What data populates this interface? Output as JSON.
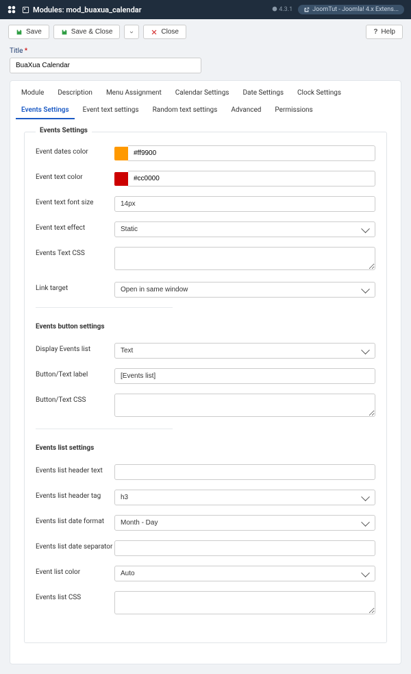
{
  "topbar": {
    "title_prefix": "Modules:",
    "title_name": "mod_buaxua_calendar",
    "version": "4.3.1",
    "ext_link_label": "JoomTut - Joomla! 4.x Extens..."
  },
  "toolbar": {
    "save": "Save",
    "save_close": "Save & Close",
    "close": "Close",
    "help": "Help"
  },
  "title": {
    "label": "Title",
    "value": "BuaXua Calendar"
  },
  "tabs": [
    "Module",
    "Description",
    "Menu Assignment",
    "Calendar Settings",
    "Date Settings",
    "Clock Settings",
    "Events Settings",
    "Event text settings",
    "Random text settings",
    "Advanced",
    "Permissions"
  ],
  "active_tab": "Events Settings",
  "fieldset_legend": "Events Settings",
  "fields": {
    "event_dates_color": {
      "label": "Event dates color",
      "value": "#ff9900",
      "swatch": "#ff9900"
    },
    "event_text_color": {
      "label": "Event text color",
      "value": "#cc0000",
      "swatch": "#cc0000"
    },
    "event_text_font_size": {
      "label": "Event text font size",
      "value": "14px"
    },
    "event_text_effect": {
      "label": "Event text effect",
      "value": "Static"
    },
    "events_text_css": {
      "label": "Events Text CSS",
      "value": ""
    },
    "link_target": {
      "label": "Link target",
      "value": "Open in same window"
    }
  },
  "section2": {
    "head": "Events button settings",
    "display_events_list": {
      "label": "Display Events list",
      "value": "Text"
    },
    "button_text_label": {
      "label": "Button/Text label",
      "value": "[Events list]"
    },
    "button_text_css": {
      "label": "Button/Text CSS",
      "value": ""
    }
  },
  "section3": {
    "head": "Events list settings",
    "header_text": {
      "label": "Events list header text",
      "value": ""
    },
    "header_tag": {
      "label": "Events list header tag",
      "value": "h3"
    },
    "date_format": {
      "label": "Events list date format",
      "value": "Month - Day"
    },
    "date_separator": {
      "label": "Events list date separator",
      "value": ""
    },
    "list_color": {
      "label": "Event list color",
      "value": "Auto"
    },
    "list_css": {
      "label": "Events list CSS",
      "value": ""
    }
  }
}
